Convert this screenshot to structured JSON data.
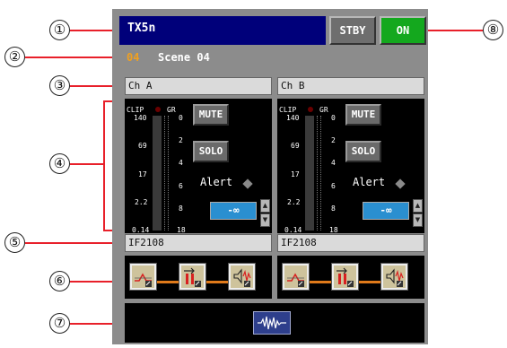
{
  "device": {
    "name": "TX5n",
    "stby_label": "STBY",
    "on_label": "ON"
  },
  "scene": {
    "number": "04",
    "name": "Scene 04"
  },
  "channels": [
    {
      "name": "Ch A",
      "meter_labels": {
        "clip": "CLIP",
        "gr": "GR"
      },
      "level_scale": [
        "140",
        "69",
        "17",
        "2.2",
        "0.14"
      ],
      "gr_scale": [
        "0",
        "2",
        "4",
        "6",
        "8",
        "18"
      ],
      "mute_label": "MUTE",
      "solo_label": "SOLO",
      "alert_label": "Alert",
      "fader_value": "-∞",
      "module": "IF2108"
    },
    {
      "name": "Ch B",
      "meter_labels": {
        "clip": "CLIP",
        "gr": "GR"
      },
      "level_scale": [
        "140",
        "69",
        "17",
        "2.2",
        "0.14"
      ],
      "gr_scale": [
        "0",
        "2",
        "4",
        "6",
        "8",
        "18"
      ],
      "mute_label": "MUTE",
      "solo_label": "SOLO",
      "alert_label": "Alert",
      "fader_value": "-∞",
      "module": "IF2108"
    }
  ],
  "callouts": [
    "①",
    "②",
    "③",
    "④",
    "⑤",
    "⑥",
    "⑦",
    "⑧"
  ],
  "colors": {
    "header_bg": "#00007a",
    "on_green": "#14a81e",
    "scene_orange": "#f0a020",
    "fader_blue": "#2a8fd0",
    "leader_red": "#e8202a"
  },
  "icons": [
    "eq-icon",
    "level-icon",
    "dynamics-icon",
    "waveform-icon"
  ]
}
